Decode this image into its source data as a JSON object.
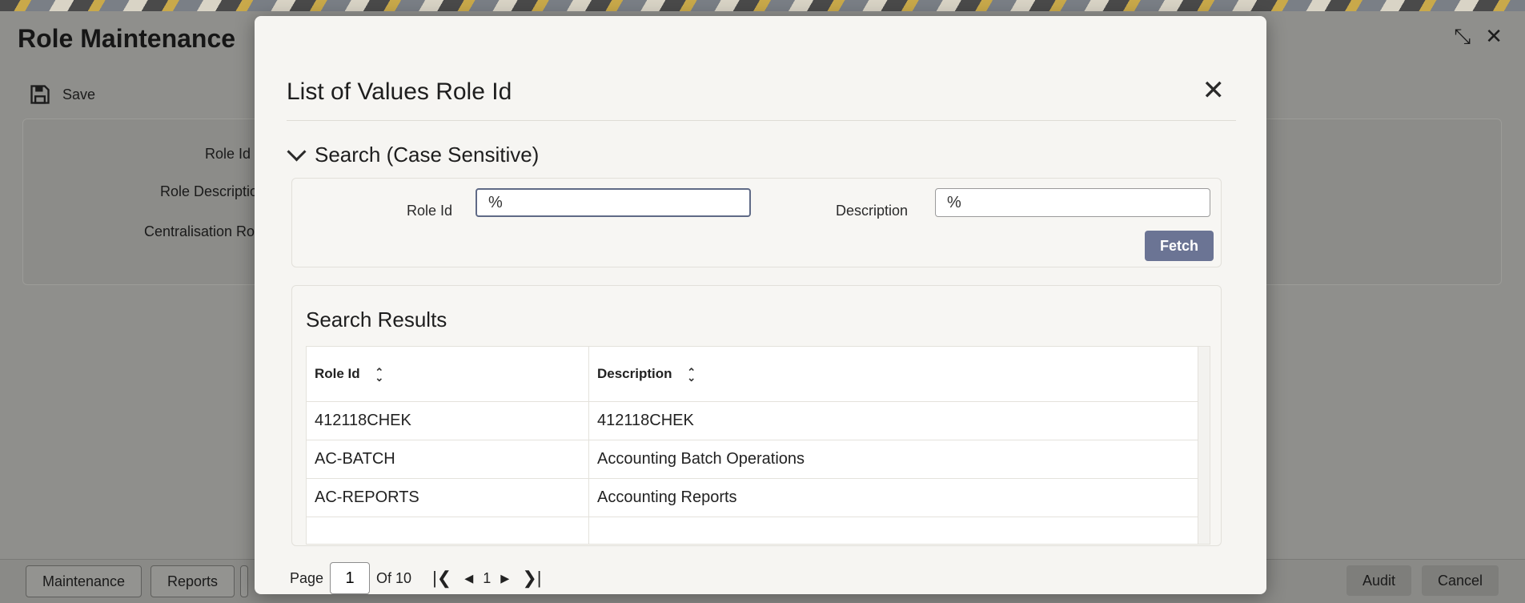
{
  "background_page": {
    "title": "Role Maintenance",
    "toolbar": {
      "save_label": "Save"
    },
    "fields": {
      "role_id_label": "Role Id",
      "role_description_label": "Role Descriptio",
      "centralisation_label": "Centralisation Ro"
    },
    "footer": {
      "maintenance_label": "Maintenance",
      "reports_label": "Reports",
      "audit_label": "Audit",
      "cancel_label": "Cancel"
    }
  },
  "modal": {
    "title": "List of Values Role Id",
    "search": {
      "heading": "Search (Case Sensitive)",
      "role_id_label": "Role Id",
      "role_id_value": "%",
      "description_label": "Description",
      "description_value": "%",
      "fetch_label": "Fetch"
    },
    "results": {
      "heading": "Search Results",
      "columns": [
        "Role Id",
        "Description"
      ],
      "rows": [
        {
          "role_id": "412118CHEK",
          "description": "412118CHEK"
        },
        {
          "role_id": "AC-BATCH",
          "description": "Accounting Batch Operations"
        },
        {
          "role_id": "AC-REPORTS",
          "description": "Accounting Reports"
        }
      ]
    },
    "pagination": {
      "page_label": "Page",
      "page_value": "1",
      "of_label": "Of 10",
      "current": "1"
    }
  }
}
